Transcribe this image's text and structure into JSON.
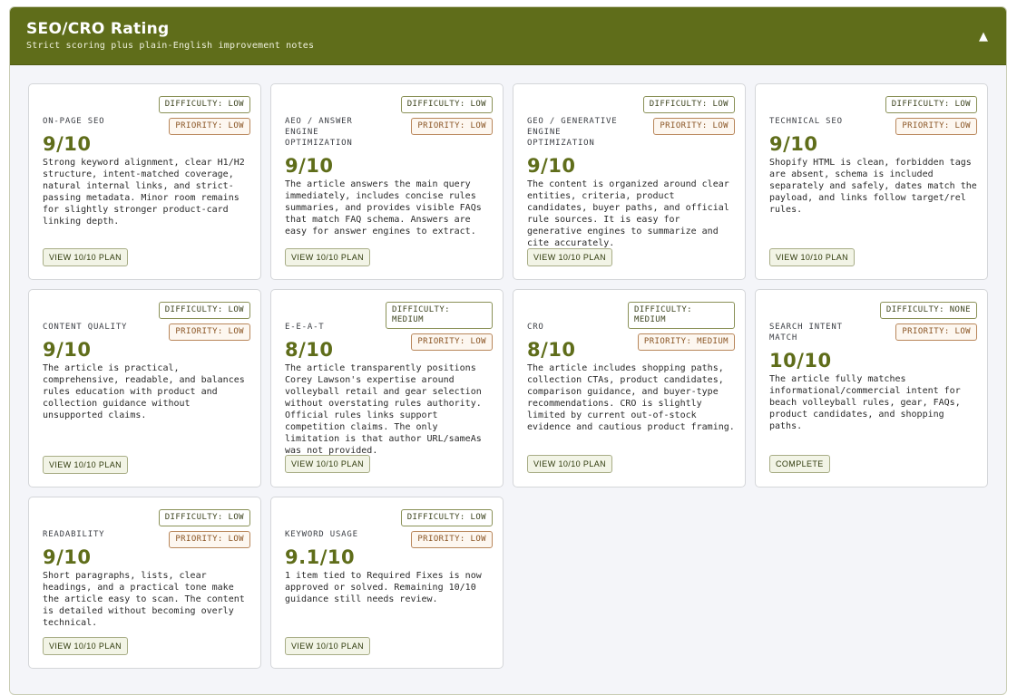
{
  "header": {
    "title": "SEO/CRO Rating",
    "subtitle": "Strict scoring plus plain-English improvement notes",
    "collapse_glyph": "▲"
  },
  "cards": [
    {
      "label": "ON-PAGE SEO",
      "difficulty": "DIFFICULTY: LOW",
      "priority": "PRIORITY: LOW",
      "score": "9/10",
      "description": "Strong keyword alignment, clear H1/H2 structure, intent-matched coverage, natural internal links, and strict-passing metadata. Minor room remains for slightly stronger product-card linking depth.",
      "action": "VIEW 10/10 PLAN"
    },
    {
      "label": "AEO / ANSWER ENGINE OPTIMIZATION",
      "difficulty": "DIFFICULTY: LOW",
      "priority": "PRIORITY: LOW",
      "score": "9/10",
      "description": "The article answers the main query immediately, includes concise rules summaries, and provides visible FAQs that match FAQ schema. Answers are easy for answer engines to extract.",
      "action": "VIEW 10/10 PLAN"
    },
    {
      "label": "GEO / GENERATIVE ENGINE OPTIMIZATION",
      "difficulty": "DIFFICULTY: LOW",
      "priority": "PRIORITY: LOW",
      "score": "9/10",
      "description": "The content is organized around clear entities, criteria, product candidates, buyer paths, and official rule sources. It is easy for generative engines to summarize and cite accurately.",
      "action": "VIEW 10/10 PLAN"
    },
    {
      "label": "TECHNICAL SEO",
      "difficulty": "DIFFICULTY: LOW",
      "priority": "PRIORITY: LOW",
      "score": "9/10",
      "description": "Shopify HTML is clean, forbidden tags are absent, schema is included separately and safely, dates match the payload, and links follow target/rel rules.",
      "action": "VIEW 10/10 PLAN"
    },
    {
      "label": "CONTENT QUALITY",
      "difficulty": "DIFFICULTY: LOW",
      "priority": "PRIORITY: LOW",
      "score": "9/10",
      "description": "The article is practical, comprehensive, readable, and balances rules education with product and collection guidance without unsupported claims.",
      "action": "VIEW 10/10 PLAN"
    },
    {
      "label": "E-E-A-T",
      "difficulty": "DIFFICULTY: MEDIUM",
      "priority": "PRIORITY: LOW",
      "score": "8/10",
      "description": "The article transparently positions Corey Lawson's expertise around volleyball retail and gear selection without overstating rules authority. Official rules links support competition claims. The only limitation is that author URL/sameAs was not provided.",
      "action": "VIEW 10/10 PLAN"
    },
    {
      "label": "CRO",
      "difficulty": "DIFFICULTY: MEDIUM",
      "priority": "PRIORITY: MEDIUM",
      "score": "8/10",
      "description": "The article includes shopping paths, collection CTAs, product candidates, comparison guidance, and buyer-type recommendations. CRO is slightly limited by current out-of-stock evidence and cautious product framing.",
      "action": "VIEW 10/10 PLAN"
    },
    {
      "label": "SEARCH INTENT MATCH",
      "difficulty": "DIFFICULTY: NONE",
      "priority": "PRIORITY: LOW",
      "score": "10/10",
      "description": "The article fully matches informational/commercial intent for beach volleyball rules, gear, FAQs, product candidates, and shopping paths.",
      "action": "COMPLETE"
    },
    {
      "label": "READABILITY",
      "difficulty": "DIFFICULTY: LOW",
      "priority": "PRIORITY: LOW",
      "score": "9/10",
      "description": "Short paragraphs, lists, clear headings, and a practical tone make the article easy to scan. The content is detailed without becoming overly technical.",
      "action": "VIEW 10/10 PLAN"
    },
    {
      "label": "KEYWORD USAGE",
      "difficulty": "DIFFICULTY: LOW",
      "priority": "PRIORITY: LOW",
      "score": "9.1/10",
      "description": "1 item tied to Required Fixes is now approved or solved. Remaining 10/10 guidance still needs review.",
      "action": "VIEW 10/10 PLAN"
    }
  ]
}
